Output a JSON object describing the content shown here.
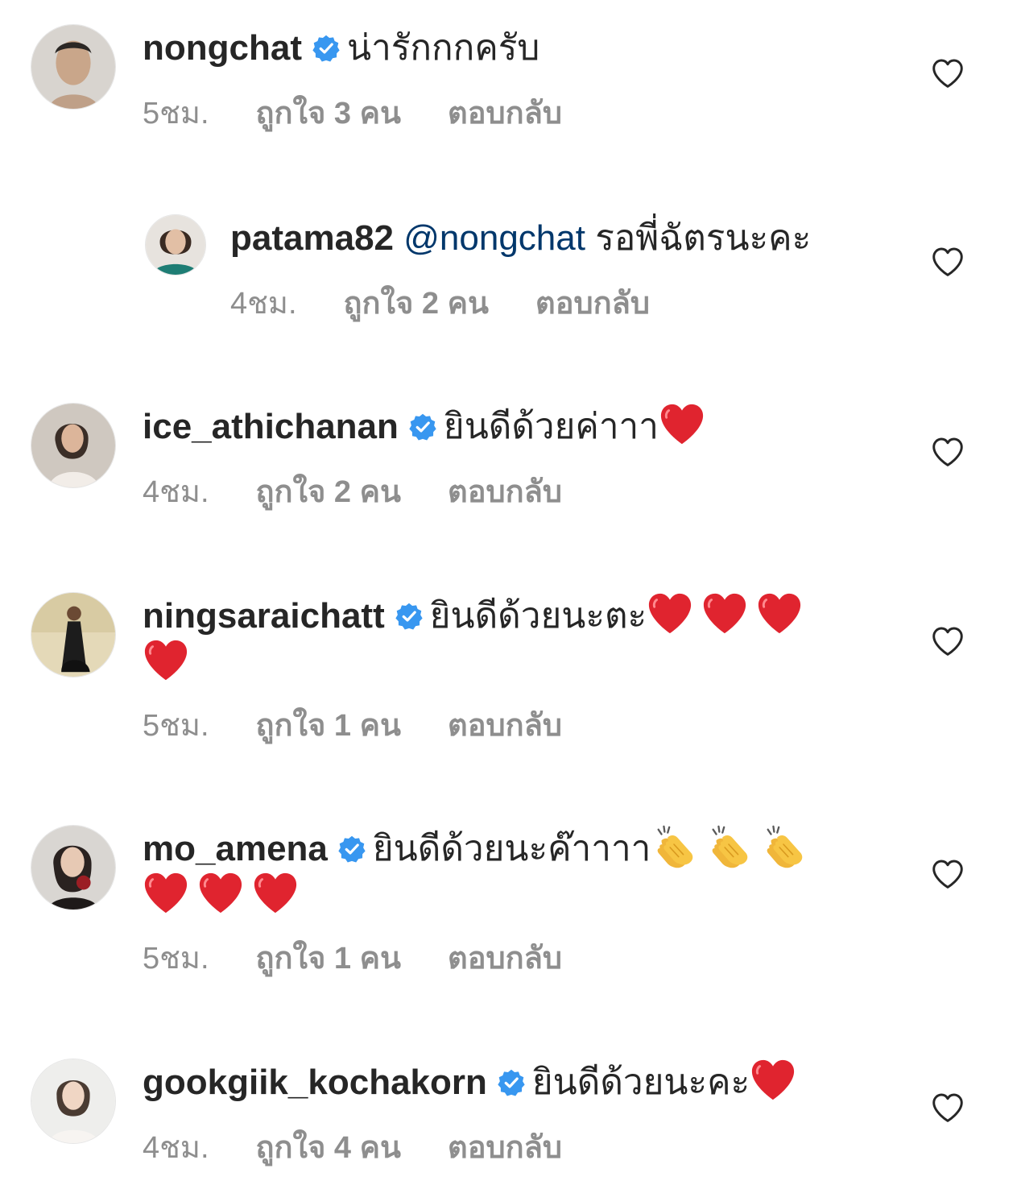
{
  "comments": [
    {
      "username": "nongchat",
      "verified": true,
      "text": "น่ารักกกครับ",
      "emojis": [],
      "time": "5ชม.",
      "likes": "ถูกใจ 3 คน",
      "reply": "ตอบกลับ"
    },
    {
      "username": "patama82",
      "verified": false,
      "mention": "@nongchat",
      "text": "รอพี่ฉัตรนะคะ",
      "emojis": [],
      "time": "4ชม.",
      "likes": "ถูกใจ 2 คน",
      "reply": "ตอบกลับ"
    },
    {
      "username": "ice_athichanan",
      "verified": true,
      "text": "ยินดีด้วยค่าาา",
      "emojis": [
        "red-heart"
      ],
      "time": "4ชม.",
      "likes": "ถูกใจ 2 คน",
      "reply": "ตอบกลับ"
    },
    {
      "username": "ningsaraichatt",
      "verified": true,
      "text": "ยินดีด้วยนะตะ",
      "emojis": [
        "red-heart",
        "red-heart",
        "red-heart",
        "red-heart"
      ],
      "time": "5ชม.",
      "likes": "ถูกใจ 1 คน",
      "reply": "ตอบกลับ"
    },
    {
      "username": "mo_amena",
      "verified": true,
      "text": "ยินดีด้วยนะค๊าาาา",
      "emojis": [
        "clapping-hands",
        "clapping-hands",
        "clapping-hands",
        "red-heart",
        "red-heart",
        "red-heart"
      ],
      "time": "5ชม.",
      "likes": "ถูกใจ 1 คน",
      "reply": "ตอบกลับ"
    },
    {
      "username": "gookgiik_kochakorn",
      "verified": true,
      "text": "ยินดีด้วยนะคะ",
      "emojis": [
        "red-heart"
      ],
      "time": "4ชม.",
      "likes": "ถูกใจ 4 คน",
      "reply": "ตอบกลับ"
    }
  ],
  "colors": {
    "verified_badge": "#3897f0",
    "mention": "#00376b",
    "meta_text": "#8e8e8e",
    "primary_text": "#262626",
    "heart_emoji": "#e0242f",
    "clap_emoji": "#f7c544"
  }
}
